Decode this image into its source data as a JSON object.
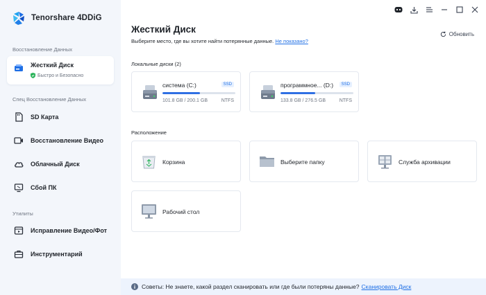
{
  "app": {
    "name": "Tenorshare 4DDiG"
  },
  "sidebar": {
    "section_recovery": "Восстановление Данных",
    "active_item": {
      "label": "Жесткий Диск",
      "sub": "Быстро и Безопасно"
    },
    "section_special": "Спец Восстановление Данных",
    "special_items": [
      {
        "label": "SD Карта",
        "icon": "sd-card-icon"
      },
      {
        "label": "Восстановление Видео",
        "icon": "video-icon"
      },
      {
        "label": "Облачный Диск",
        "icon": "cloud-icon"
      },
      {
        "label": "Сбой ПК",
        "icon": "pc-crash-icon"
      }
    ],
    "section_utils": "Утилиты",
    "util_items": [
      {
        "label": "Исправление Видео/Фот",
        "icon": "repair-icon"
      },
      {
        "label": "Инструментарий",
        "icon": "toolbox-icon"
      }
    ]
  },
  "main": {
    "title": "Жесткий Диск",
    "subtitle": "Выберите место, где вы хотите найти потерянные данные.",
    "subtitle_link": "Не показано?",
    "refresh_label": "Обновить",
    "local_disks_label": "Локальные диски (2)",
    "drives": [
      {
        "name": "система (C:)",
        "badge": "SSD",
        "size": "101.8 GB / 200.1 GB",
        "fs": "NTFS",
        "used_fraction": 0.51
      },
      {
        "name": "программное... (D:)",
        "badge": "SSD",
        "size": "133.8 GB / 276.5 GB",
        "fs": "NTFS",
        "used_fraction": 0.48
      }
    ],
    "locations_label": "Расположение",
    "locations": [
      {
        "label": "Корзина",
        "icon": "recycle-bin-icon"
      },
      {
        "label": "Выберите папку",
        "icon": "folder-icon"
      },
      {
        "label": "Служба архивации",
        "icon": "backup-monitor-icon"
      },
      {
        "label": "Рабочий стол",
        "icon": "desktop-icon"
      }
    ]
  },
  "footer": {
    "tip": "Советы: Не знаете, какой раздел сканировать или где были потеряны данные?",
    "link": "Сканировать Диск"
  },
  "colors": {
    "accent": "#1f6fe5",
    "bar": "#2f6fe3",
    "sidebar_bg": "#f3f6fb",
    "footer_bg": "#edf3fd"
  }
}
